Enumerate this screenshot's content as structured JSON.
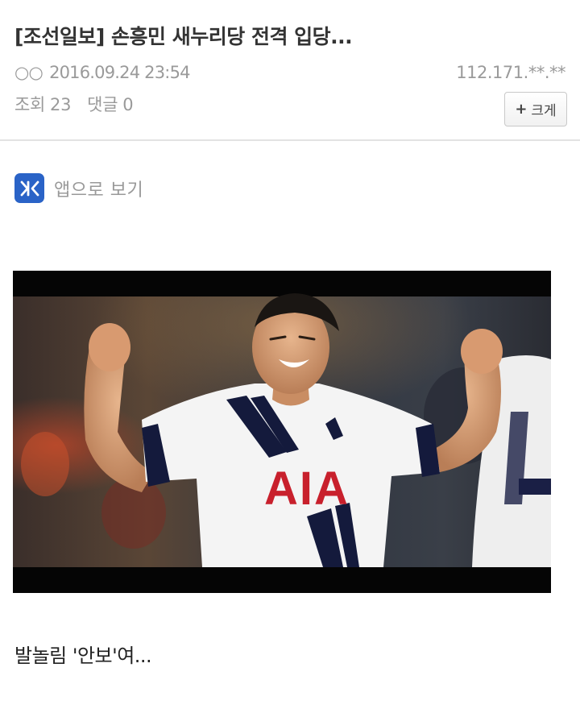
{
  "post": {
    "title": "[조선일보] 손흥민 새누리당 전격 입당...",
    "author": "○○",
    "datetime": "2016.09.24 23:54",
    "ip": "112.171.**.**",
    "views_label": "조회",
    "views": "23",
    "comments_label": "댓글",
    "comments": "0",
    "zoom_label": "크게"
  },
  "app_link": {
    "label": "앱으로 보기",
    "icon": "app-logo-icon"
  },
  "image": {
    "description_icon": "football-player-celebrating-photo",
    "jersey_text": "AIA",
    "colors": {
      "jersey": "#f4f4f4",
      "sponsor": "#c8202c",
      "navy": "#141a3c"
    }
  },
  "body": {
    "text": "발놀림 '안보'여..."
  }
}
